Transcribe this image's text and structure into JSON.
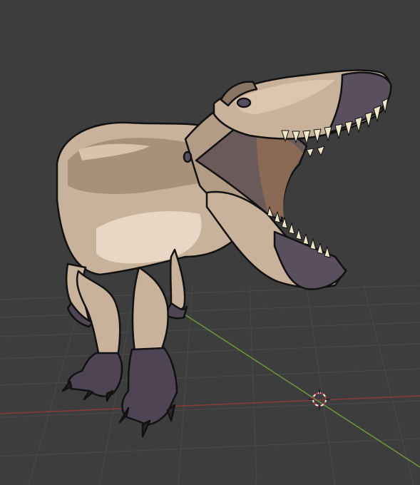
{
  "viewport": {
    "background_color": "#3d3d3d",
    "grid_color": "#4a4a4a",
    "x_axis_color": "#8a3a3a",
    "y_axis_color": "#6a9a3a"
  },
  "scene": {
    "object": "dinosaur-model",
    "shading": "toon",
    "palette": {
      "skin_light": "#d9c3ad",
      "skin_mid": "#b8a08a",
      "skin_dark": "#8a7563",
      "belly": "#e8d7c4",
      "mouth_inner": "#6b5a5a",
      "snout_dark": "#5a4f5e",
      "claw": "#4e4453",
      "teeth": "#f0e7c8",
      "outline": "#111111"
    }
  },
  "cursor_3d": {
    "icon": "3d-cursor-icon",
    "ring_color": "#cc3333",
    "ring_alt_color": "#ffffff"
  }
}
